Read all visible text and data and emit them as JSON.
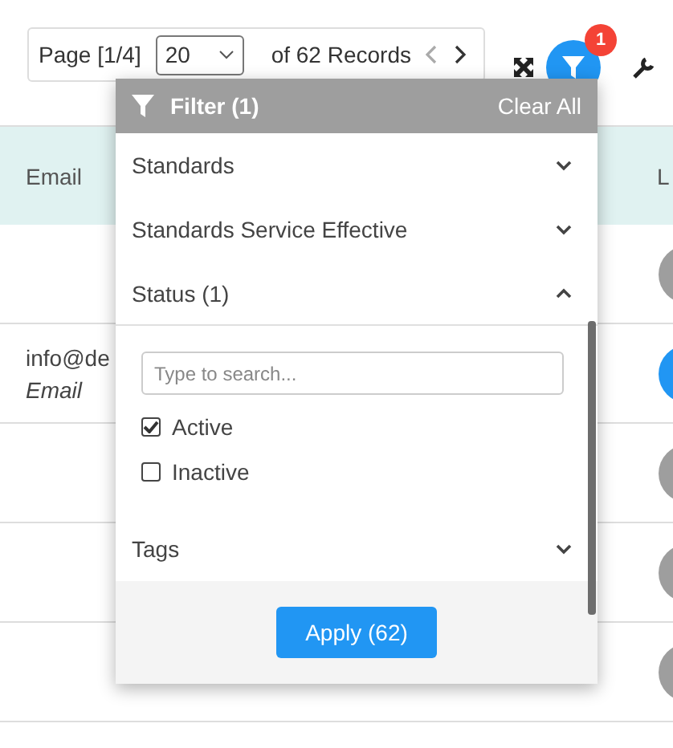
{
  "pager": {
    "page_label": "Page [1/4]",
    "page_size": "20",
    "records": "of 62 Records"
  },
  "toolbar": {
    "filter_badge": "1"
  },
  "table": {
    "columns": [
      "Email",
      "L"
    ],
    "rows": [
      {
        "email": "",
        "note": "",
        "color": "#9e9e9e"
      },
      {
        "email": "info@de",
        "note": "Email",
        "color": "#2196f3"
      },
      {
        "email": "",
        "note": "",
        "color": "#9e9e9e"
      },
      {
        "email": "",
        "note": "",
        "color": "#9e9e9e"
      },
      {
        "email": "",
        "note": "",
        "color": "#9e9e9e"
      }
    ]
  },
  "filter": {
    "title": "Filter (1)",
    "clear": "Clear All",
    "sections": [
      {
        "label": "Standards",
        "expanded": false
      },
      {
        "label": "Standards Service Effective",
        "expanded": false
      },
      {
        "label": "Status (1)",
        "expanded": true,
        "placeholder": "Type to search...",
        "options": [
          {
            "label": "Active",
            "checked": true
          },
          {
            "label": "Inactive",
            "checked": false
          }
        ]
      },
      {
        "label": "Tags",
        "expanded": false
      }
    ],
    "apply": "Apply (62)"
  }
}
